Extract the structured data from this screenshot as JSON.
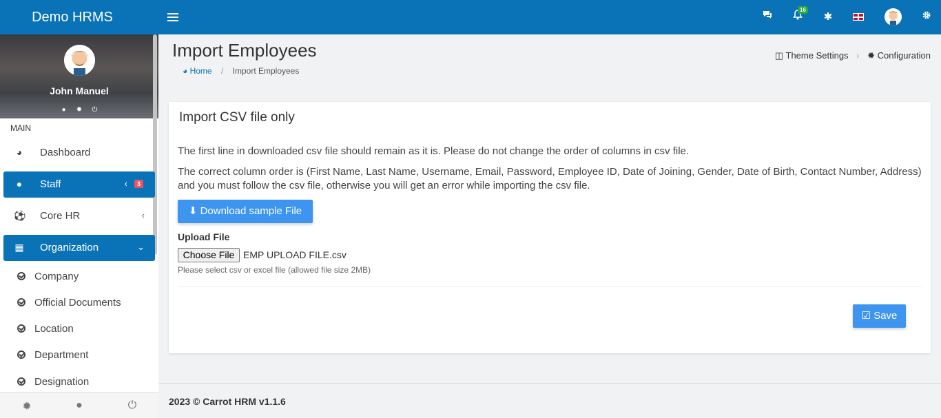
{
  "app": {
    "brand": "Demo HRMS"
  },
  "topbar": {
    "notification_count": "16"
  },
  "user": {
    "name": "John Manuel"
  },
  "sidebar": {
    "section": "MAIN",
    "items": [
      {
        "label": "Dashboard"
      },
      {
        "label": "Staff",
        "badge": "3"
      },
      {
        "label": "Core HR"
      },
      {
        "label": "Organization"
      }
    ],
    "subitems": [
      {
        "label": "Company"
      },
      {
        "label": "Official Documents"
      },
      {
        "label": "Location"
      },
      {
        "label": "Department"
      },
      {
        "label": "Designation"
      }
    ]
  },
  "page": {
    "title": "Import Employees",
    "breadcrumb": {
      "home": "Home",
      "current": "Import Employees"
    },
    "links": {
      "theme": "Theme Settings",
      "config": "Configuration"
    }
  },
  "card": {
    "title": "Import CSV file only",
    "para1": "The first line in downloaded csv file should remain as it is. Please do not change the order of columns in csv file.",
    "para2": "The correct column order is (First Name, Last Name, Username, Email, Password, Employee ID, Date of Joining, Gender, Date of Birth, Contact Number, Address) and you must follow the csv file, otherwise you will get an error while importing the csv file.",
    "download_label": "Download sample File",
    "upload_label": "Upload File",
    "choose_file_label": "Choose File",
    "file_name": "EMP UPLOAD FILE.csv",
    "help": "Please select csv or excel file (allowed file size 2MB)",
    "save_label": "Save"
  },
  "footer": {
    "copyright": "2023 © Carrot HRM v1.1.6"
  },
  "colors": {
    "primary": "#0a73b7",
    "button": "#3d95f0",
    "badge_red": "#f0535e",
    "badge_green": "#28a745"
  }
}
